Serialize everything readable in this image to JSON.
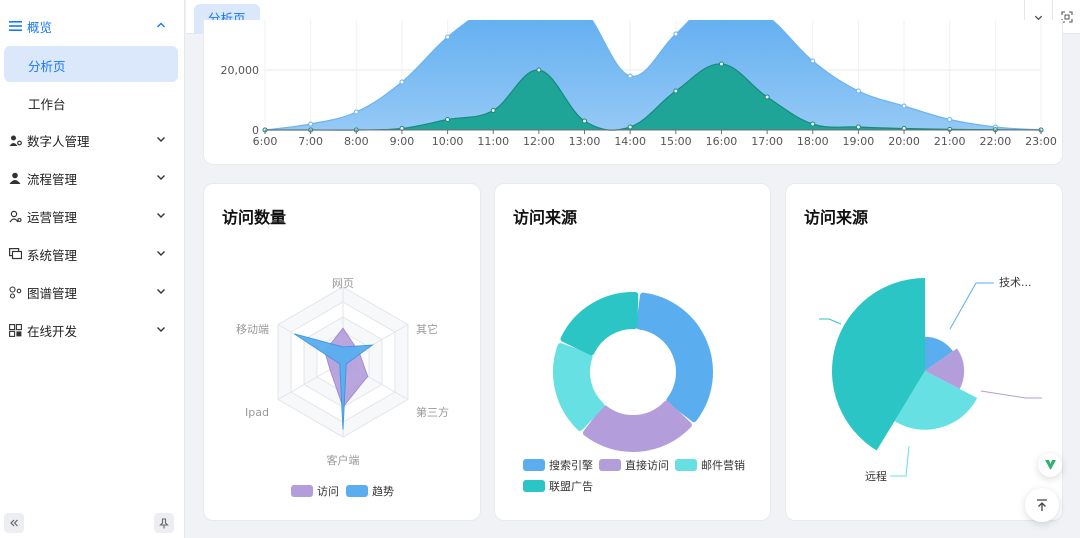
{
  "sidebar": {
    "top_menu": {
      "label": "概览",
      "icon": "menu-lines-icon"
    },
    "sub_items": [
      {
        "label": "分析页",
        "active": true
      },
      {
        "label": "工作台",
        "active": false
      }
    ],
    "items": [
      {
        "label": "数字人管理",
        "icon": "digital-human-icon"
      },
      {
        "label": "流程管理",
        "icon": "user-icon"
      },
      {
        "label": "运营管理",
        "icon": "operator-icon"
      },
      {
        "label": "系统管理",
        "icon": "monitor-icon"
      },
      {
        "label": "图谱管理",
        "icon": "graph-icon"
      },
      {
        "label": "在线开发",
        "icon": "code-icon"
      }
    ]
  },
  "tabbar": {
    "active_tab": "分析页"
  },
  "colors": {
    "accent": "#1677ff",
    "blue": "#5aaef0",
    "purple": "#b39ddb",
    "teal": "#2cc5c5",
    "cyan": "#67e0e3",
    "green": "#1a9e8f"
  },
  "area_chart": {
    "chart_data": {
      "type": "area",
      "x": [
        "6:00",
        "7:00",
        "8:00",
        "9:00",
        "10:00",
        "11:00",
        "12:00",
        "13:00",
        "14:00",
        "15:00",
        "16:00",
        "17:00",
        "18:00",
        "19:00",
        "20:00",
        "21:00",
        "22:00",
        "23:00"
      ],
      "ytick_labels": [
        "0",
        "20,000"
      ],
      "yticks": [
        0,
        20000
      ],
      "ylim": [
        0,
        40000
      ],
      "series": [
        {
          "values": [
            0,
            2000,
            6000,
            16000,
            31000,
            42000,
            50000,
            40000,
            18000,
            32000,
            45000,
            38000,
            23000,
            13000,
            8000,
            3500,
            1000,
            0
          ]
        },
        {
          "values": [
            0,
            0,
            0,
            500,
            3500,
            6500,
            20000,
            3000,
            1000,
            13000,
            22000,
            11000,
            2000,
            1000,
            500,
            200,
            100,
            0
          ]
        }
      ]
    }
  },
  "radar_card": {
    "title": "访问数量",
    "chart_data": {
      "type": "radar",
      "indicators": [
        "网页",
        "其它",
        "第三方",
        "客户端",
        "Ipad",
        "移动端"
      ],
      "max": 100,
      "series": [
        {
          "name": "访问",
          "values": [
            45,
            25,
            38,
            60,
            20,
            28
          ]
        },
        {
          "name": "趋势",
          "values": [
            20,
            45,
            5,
            90,
            5,
            75
          ]
        }
      ]
    }
  },
  "donut_card": {
    "title": "访问来源",
    "chart_data": {
      "type": "pie",
      "categories": [
        "搜索引擎",
        "直接访问",
        "邮件营销",
        "联盟广告"
      ],
      "values": [
        35,
        25,
        20,
        20
      ]
    }
  },
  "rose_card": {
    "title": "访问来源",
    "chart_data": {
      "type": "pie",
      "categories": [
        "技术...",
        "",
        "远程",
        ""
      ],
      "values": [
        35,
        40,
        60,
        95
      ]
    }
  }
}
